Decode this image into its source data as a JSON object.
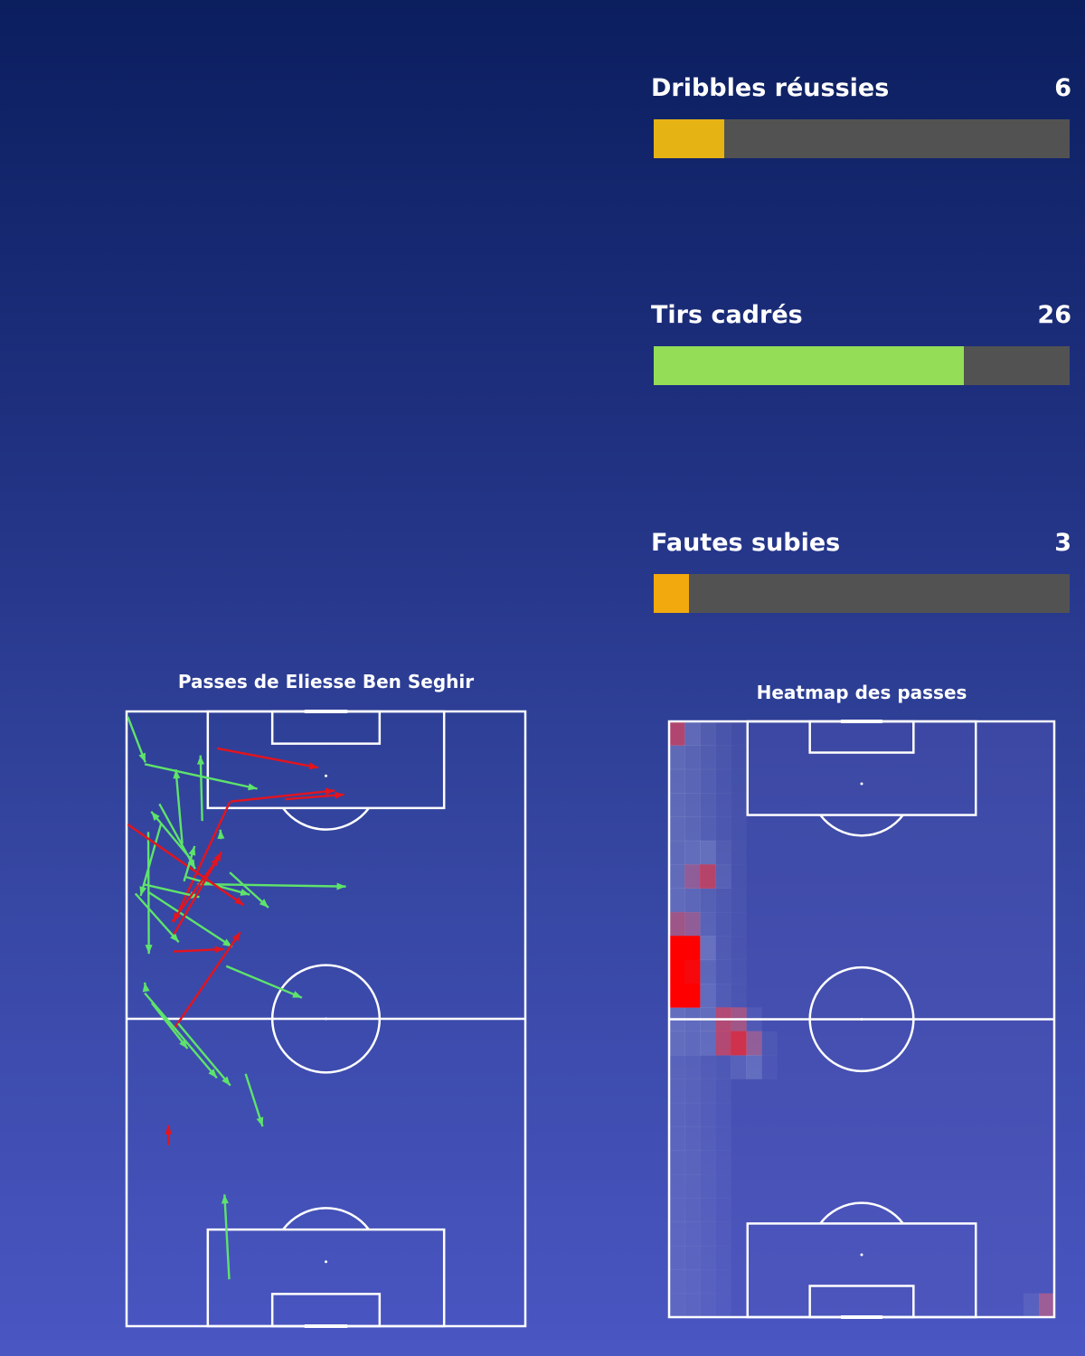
{
  "stats": [
    {
      "label": "Dribbles réussies",
      "value": "6",
      "fraction": 0.17,
      "color": "#e6b315"
    },
    {
      "label": "Tirs cadrés",
      "value": "26",
      "fraction": 0.745,
      "color": "#93dd57"
    },
    {
      "label": "Fautes subies",
      "value": "3",
      "fraction": 0.085,
      "color": "#f2a90e"
    }
  ],
  "chart_data": [
    {
      "type": "scatter",
      "title": "Passes de Eliesse Ben Seghir",
      "xlim": [
        0,
        68
      ],
      "ylim": [
        0,
        105
      ],
      "colors": {
        "successful": "#5ee36b",
        "failed": "#e3141e"
      },
      "passes": [
        {
          "x": 0.2,
          "y": 104.1,
          "x2": 3.2,
          "y2": 96.3,
          "outcome": "successful"
        },
        {
          "x": 3.1,
          "y": 96.0,
          "x2": 22.3,
          "y2": 91.8,
          "outcome": "successful"
        },
        {
          "x": 15.4,
          "y": 98.7,
          "x2": 32.7,
          "y2": 95.4,
          "outcome": "failed"
        },
        {
          "x": 12.9,
          "y": 86.3,
          "x2": 12.6,
          "y2": 97.5,
          "outcome": "successful"
        },
        {
          "x": 9.5,
          "y": 82.4,
          "x2": 8.4,
          "y2": 95.1,
          "outcome": "successful"
        },
        {
          "x": 5.6,
          "y": 89.2,
          "x2": 11.7,
          "y2": 78.1,
          "outcome": "successful"
        },
        {
          "x": 17.7,
          "y": 89.6,
          "x2": 35.5,
          "y2": 91.5,
          "outcome": "failed"
        },
        {
          "x": 27.0,
          "y": 90.0,
          "x2": 37.1,
          "y2": 90.8,
          "outcome": "failed"
        },
        {
          "x": 17.6,
          "y": 89.5,
          "x2": 8.0,
          "y2": 69.0,
          "outcome": "failed"
        },
        {
          "x": 5.9,
          "y": 85.9,
          "x2": 2.4,
          "y2": 73.5,
          "outcome": "successful"
        },
        {
          "x": 3.7,
          "y": 84.4,
          "x2": 3.8,
          "y2": 63.6,
          "outcome": "successful"
        },
        {
          "x": 17.6,
          "y": 77.5,
          "x2": 24.2,
          "y2": 71.5,
          "outcome": "successful"
        },
        {
          "x": 10.2,
          "y": 76.7,
          "x2": 21.0,
          "y2": 73.7,
          "outcome": "successful"
        },
        {
          "x": 12.1,
          "y": 75.5,
          "x2": 37.4,
          "y2": 75.1,
          "outcome": "successful"
        },
        {
          "x": 0.2,
          "y": 85.7,
          "x2": 20.0,
          "y2": 71.9,
          "outcome": "failed"
        },
        {
          "x": 1.5,
          "y": 73.9,
          "x2": 8.9,
          "y2": 65.6,
          "outcome": "successful"
        },
        {
          "x": 2.8,
          "y": 75.5,
          "x2": 12.4,
          "y2": 73.3,
          "outcome": "successful"
        },
        {
          "x": 3.8,
          "y": 74.1,
          "x2": 18.0,
          "y2": 64.8,
          "outcome": "successful"
        },
        {
          "x": 16.1,
          "y": 83.2,
          "x2": 16.0,
          "y2": 84.8,
          "outcome": "successful"
        },
        {
          "x": 11.2,
          "y": 79.5,
          "x2": 4.2,
          "y2": 87.9,
          "outcome": "successful"
        },
        {
          "x": 9.8,
          "y": 76.0,
          "x2": 11.6,
          "y2": 82.0,
          "outcome": "successful"
        },
        {
          "x": 8.1,
          "y": 67.0,
          "x2": 16.2,
          "y2": 81.0,
          "outcome": "failed"
        },
        {
          "x": 8.0,
          "y": 64.0,
          "x2": 16.6,
          "y2": 64.4,
          "outcome": "failed"
        },
        {
          "x": 7.8,
          "y": 69.1,
          "x2": 15.8,
          "y2": 80.2,
          "outcome": "failed"
        },
        {
          "x": 17.0,
          "y": 61.5,
          "x2": 29.9,
          "y2": 56.1,
          "outcome": "successful"
        },
        {
          "x": 7.9,
          "y": 50.5,
          "x2": 19.4,
          "y2": 67.3,
          "outcome": "failed"
        },
        {
          "x": 3.3,
          "y": 57.4,
          "x2": 3.1,
          "y2": 58.7,
          "outcome": "successful"
        },
        {
          "x": 3.1,
          "y": 56.9,
          "x2": 15.4,
          "y2": 42.4,
          "outcome": "successful"
        },
        {
          "x": 8.8,
          "y": 51.7,
          "x2": 17.7,
          "y2": 41.1,
          "outcome": "successful"
        },
        {
          "x": 4.3,
          "y": 55.2,
          "x2": 10.4,
          "y2": 47.4,
          "outcome": "successful"
        },
        {
          "x": 20.3,
          "y": 43.1,
          "x2": 23.2,
          "y2": 34.1,
          "outcome": "successful"
        },
        {
          "x": 7.2,
          "y": 30.9,
          "x2": 7.1,
          "y2": 34.3,
          "outcome": "failed"
        },
        {
          "x": 17.5,
          "y": 8.0,
          "x2": 16.7,
          "y2": 22.5,
          "outcome": "successful"
        }
      ]
    },
    {
      "type": "heatmap",
      "title": "Heatmap des passes",
      "xlim": [
        0,
        68
      ],
      "ylim": [
        0,
        105
      ],
      "hot_zones": [
        {
          "x": 1.3,
          "y": 62.2,
          "w": 1.0
        },
        {
          "x": 3.9,
          "y": 65.6,
          "w": 0.8
        },
        {
          "x": 1.3,
          "y": 58.0,
          "w": 0.75
        },
        {
          "x": 3.9,
          "y": 58.0,
          "w": 0.6
        },
        {
          "x": 6.6,
          "y": 79.2,
          "w": 0.6
        },
        {
          "x": 11.9,
          "y": 50.4,
          "w": 0.8
        },
        {
          "x": 14.5,
          "y": 46.2,
          "w": 0.72
        },
        {
          "x": 9.2,
          "y": 50.4,
          "w": 0.58
        },
        {
          "x": 1.3,
          "y": 66.2,
          "w": 0.45
        },
        {
          "x": 66.7,
          "y": 2.1,
          "w": 0.6
        },
        {
          "x": 1.3,
          "y": 103.8,
          "w": 0.3
        }
      ]
    }
  ]
}
